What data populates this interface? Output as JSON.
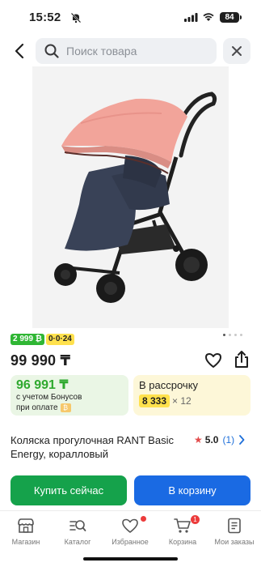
{
  "status_bar": {
    "time": "15:52",
    "battery": "84"
  },
  "header": {
    "search_placeholder": "Поиск товара"
  },
  "gallery": {
    "slides": 4,
    "active_slide": 1
  },
  "badges": {
    "bonus_badge": "2 999 ₿",
    "installment_badge": "0·0·24"
  },
  "product": {
    "price": "99 990 ₸",
    "title": "Коляска прогулочная RANT Basic Energy, коралловый",
    "rating": "5.0",
    "reviews": "(1)"
  },
  "bonus": {
    "price": "96 991 ₸",
    "note_line1": "с учетом Бонусов",
    "note_line2": "при оплате"
  },
  "installment": {
    "title": "В рассрочку",
    "amount": "8 333",
    "months": "× 12"
  },
  "actions": {
    "buy_now": "Купить сейчас",
    "add_to_cart": "В корзину"
  },
  "tab_bar": {
    "shop": "Магазин",
    "catalog": "Каталог",
    "favorites": "Избранное",
    "cart": "Корзина",
    "cart_count": "1",
    "orders": "Мои заказы"
  },
  "colors": {
    "buy_now": "#15a24b",
    "add_to_cart": "#1a6ae3",
    "bonus_green": "#2fa92f",
    "yellow": "#ffe14d",
    "stroller_canopy": "#f2a49a",
    "stroller_body": "#394257"
  }
}
